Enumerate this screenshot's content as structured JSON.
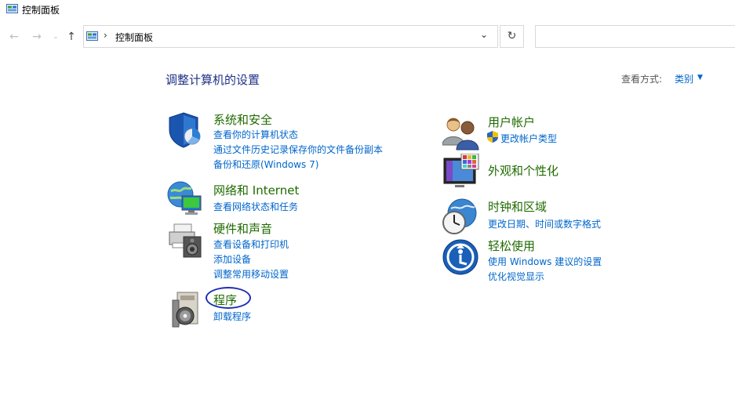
{
  "window": {
    "title": "控制面板"
  },
  "toolbar": {
    "back_icon": "back-arrow-icon",
    "forward_icon": "forward-arrow-icon",
    "recent_icon": "chevron-down-icon",
    "up_icon": "up-arrow-icon",
    "breadcrumb_separator": "›",
    "address": "控制面板",
    "refresh_icon": "refresh-icon",
    "search_value": ""
  },
  "header": {
    "title": "调整计算机的设置",
    "view_by_label": "查看方式:",
    "view_by_value": "类别"
  },
  "categories": {
    "security": {
      "title": "系统和安全",
      "links": [
        "查看你的计算机状态",
        "通过文件历史记录保存你的文件备份副本",
        "备份和还原(Windows 7)"
      ]
    },
    "network": {
      "title": "网络和 Internet",
      "links": [
        "查看网络状态和任务"
      ]
    },
    "hardware": {
      "title": "硬件和声音",
      "links": [
        "查看设备和打印机",
        "添加设备",
        "调整常用移动设置"
      ]
    },
    "programs": {
      "title": "程序",
      "links": [
        "卸载程序"
      ]
    },
    "accounts": {
      "title": "用户帐户",
      "links": [
        "更改帐户类型"
      ]
    },
    "appearance": {
      "title": "外观和个性化",
      "links": []
    },
    "clock": {
      "title": "时钟和区域",
      "links": [
        "更改日期、时间或数字格式"
      ]
    },
    "ease": {
      "title": "轻松使用",
      "links": [
        "使用 Windows 建议的设置",
        "优化视觉显示"
      ]
    }
  },
  "colors": {
    "category_title": "#1f6b00",
    "link": "#0066cc",
    "heading": "#1e3287",
    "annotation_circle": "#1e2fb5"
  }
}
